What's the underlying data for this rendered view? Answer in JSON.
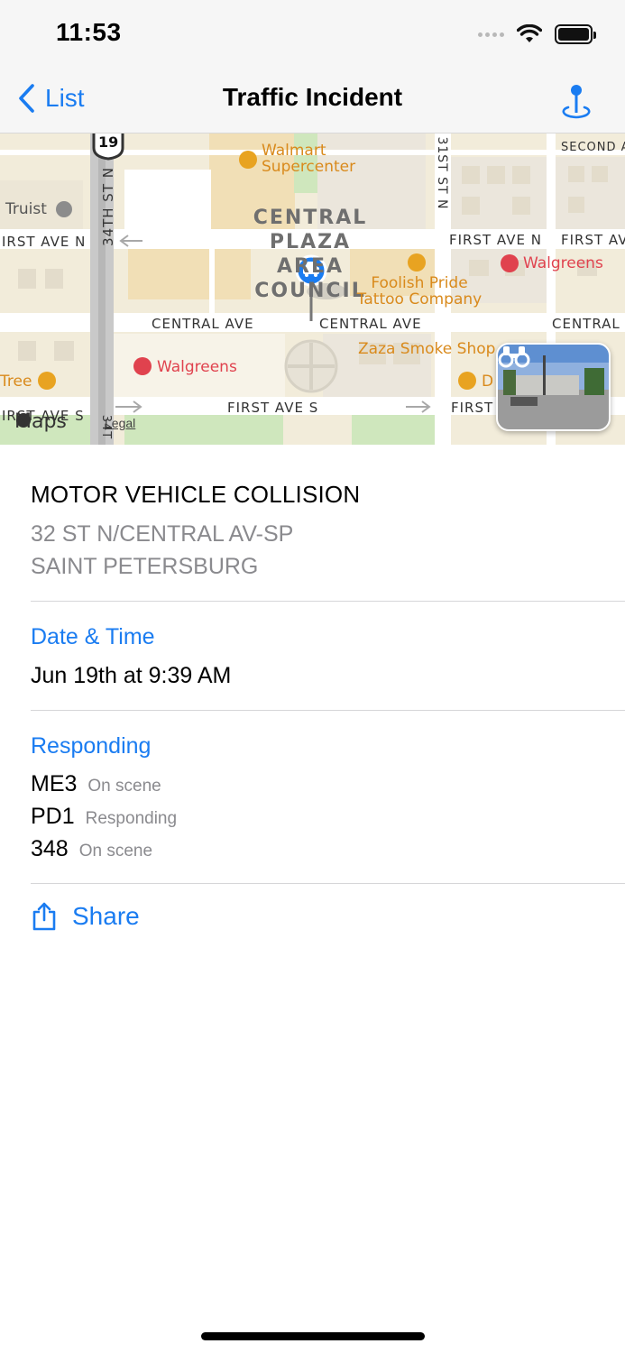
{
  "status_bar": {
    "time": "11:53"
  },
  "nav": {
    "back_label": "List",
    "title": "Traffic Incident"
  },
  "map": {
    "route_shield": "19",
    "streets": {
      "first_ave_n_left": "IRST AVE N",
      "first_ave_n_right": "FIRST AVE N",
      "first_ave_n_far": "FIRST AV",
      "central_ave_1": "CENTRAL AVE",
      "central_ave_2": "CENTRAL AVE",
      "central_ave_3": "CENTRAL",
      "first_ave_s_left": "IRST AVE S",
      "first_ave_s_mid": "FIRST AVE S",
      "first_ave_s_right": "FIRST",
      "street_34th": "34TH ST N",
      "street_31st": "31ST ST N",
      "second_ave": "SECOND A",
      "street_34_short": "34T"
    },
    "area_label": "CENTRAL PLAZA AREA COUNCIL",
    "pois": {
      "walmart": "Walmart Supercenter",
      "truist": "Truist",
      "walgreens_1": "Walgreens",
      "walgreens_2": "Walgreens",
      "foolish_pride": "Foolish Pride Tattoo Company",
      "zaza": "Zaza Smoke Shop",
      "tree": "Tree",
      "d_store": "D"
    },
    "maps_logo": "Maps",
    "legal": "Legal"
  },
  "incident": {
    "type": "MOTOR VEHICLE COLLISION",
    "address_line1": "32 ST N/CENTRAL AV-SP",
    "address_line2": "SAINT PETERSBURG"
  },
  "date_time": {
    "heading": "Date & Time",
    "value": "Jun 19th at 9:39 AM"
  },
  "responding": {
    "heading": "Responding",
    "units": [
      {
        "id": "ME3",
        "status": "On scene"
      },
      {
        "id": "PD1",
        "status": "Responding"
      },
      {
        "id": "348",
        "status": "On scene"
      }
    ]
  },
  "share": {
    "label": "Share"
  },
  "colors": {
    "accent": "#1a7cf1",
    "secondary_text": "#8a8a8e",
    "poi_orange": "#d98a1c",
    "poi_red": "#e0424e"
  },
  "icons": [
    "chevron-left-icon",
    "map-pin-icon",
    "binoculars-icon",
    "share-icon",
    "car-icon",
    "wifi-icon",
    "battery-icon"
  ]
}
